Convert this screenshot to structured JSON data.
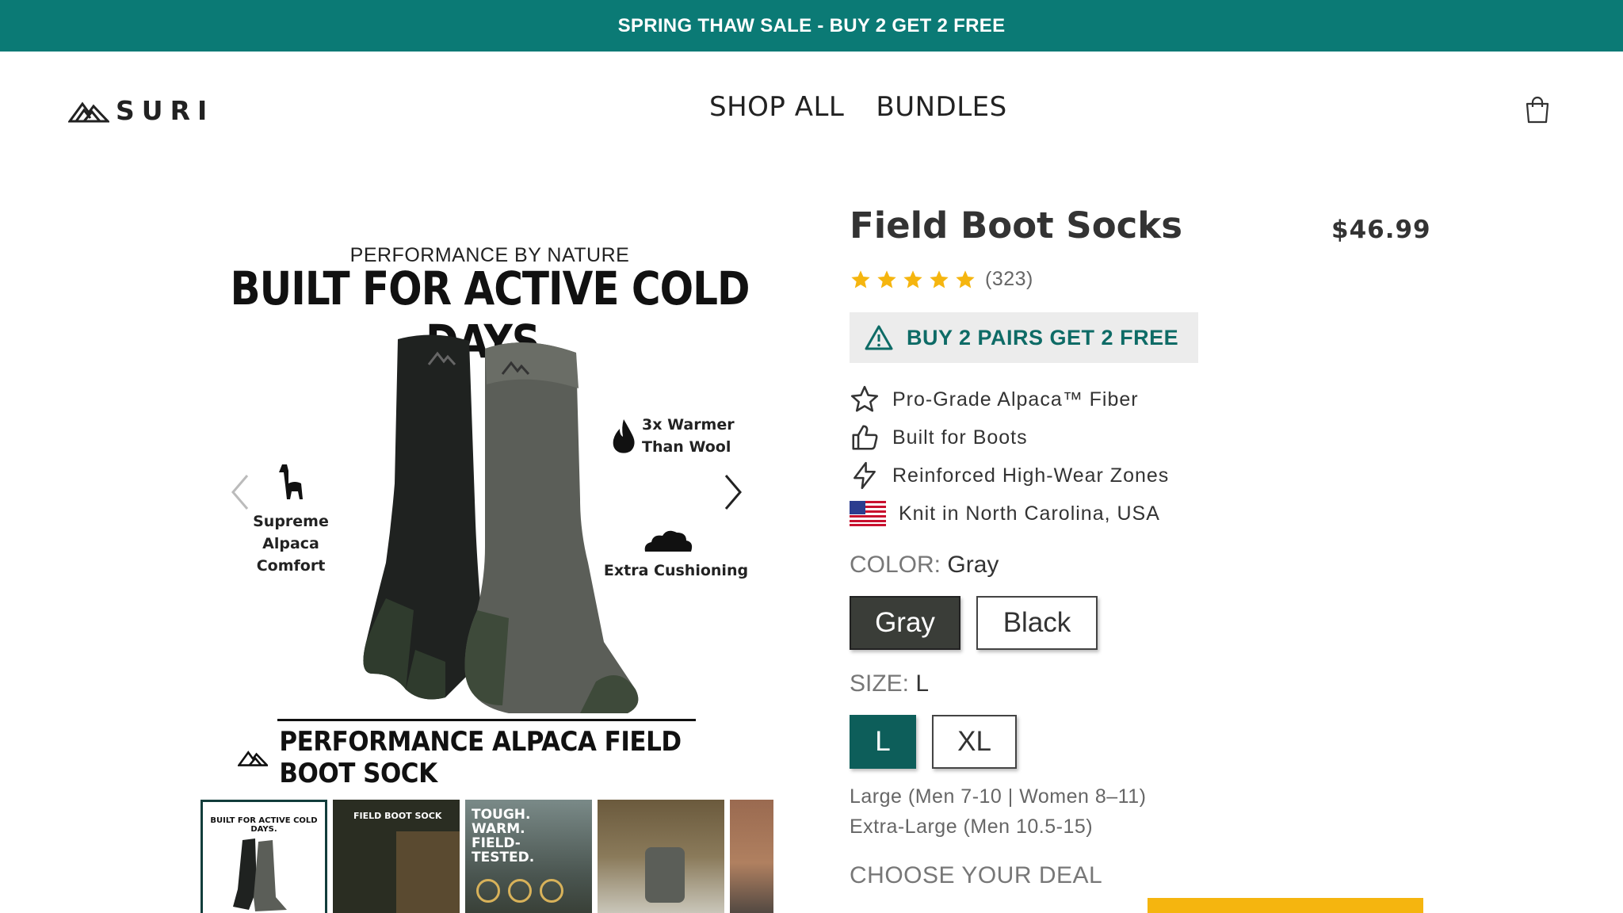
{
  "announcement": {
    "text": "SPRING THAW SALE - BUY 2 GET 2 FREE"
  },
  "header": {
    "logo_text": "SURI",
    "nav": [
      "SHOP ALL",
      "BUNDLES"
    ]
  },
  "gallery": {
    "main_image": {
      "subtitle": "PERFORMANCE BY NATURE",
      "title": "BUILT FOR ACTIVE COLD DAYS.",
      "features": {
        "alpaca_line1": "Supreme Alpaca",
        "alpaca_line2": "Comfort",
        "warmer_line1": "3x Warmer",
        "warmer_line2": "Than Wool",
        "cushioning": "Extra Cushioning"
      },
      "footer": "PERFORMANCE ALPACA FIELD BOOT SOCK"
    },
    "thumbnails": [
      {
        "title": "BUILT FOR ACTIVE COLD DAYS.",
        "active": true
      },
      {
        "title": "FIELD BOOT SOCK"
      },
      {
        "title": "TOUGH. WARM. FIELD-TESTED."
      },
      {
        "title": ""
      },
      {
        "title": ""
      }
    ]
  },
  "product": {
    "title": "Field Boot Socks",
    "price": "$46.99",
    "rating": {
      "stars": 5,
      "count": "(323)"
    },
    "promo": "BUY 2 PAIRS GET 2 FREE",
    "bullets": [
      {
        "icon": "star-outline-icon",
        "text": "Pro-Grade Alpaca™ Fiber"
      },
      {
        "icon": "thumbs-up-icon",
        "text": "Built for Boots"
      },
      {
        "icon": "lightning-icon",
        "text": "Reinforced High-Wear Zones"
      },
      {
        "icon": "us-flag-icon",
        "text": "Knit in North Carolina, USA"
      }
    ],
    "color": {
      "label": "COLOR:",
      "selected": "Gray",
      "options": [
        "Gray",
        "Black"
      ]
    },
    "size": {
      "label": "SIZE:",
      "selected": "L",
      "options": [
        "L",
        "XL"
      ]
    },
    "size_guide": [
      "Large (Men 7-10 | Women 8–11)",
      "Extra-Large (Men 10.5-15)"
    ],
    "deal_label": "CHOOSE YOUR DEAL"
  },
  "colors": {
    "brand": "#0b7a75",
    "promo_text": "#0e6b66",
    "star": "#f5b50f",
    "deal_button": "#f5b50f"
  }
}
